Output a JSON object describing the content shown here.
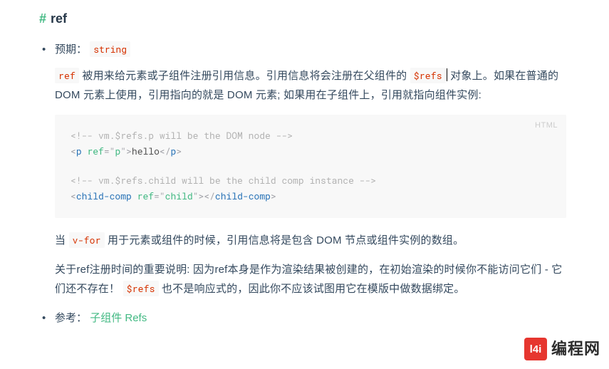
{
  "heading": {
    "hash": "#",
    "title": "ref"
  },
  "items": {
    "expected": {
      "label": "预期：",
      "code": "string"
    },
    "desc1": {
      "pre1": "",
      "code_ref": "ref",
      "text1": " 被用来给元素或子组件注册引用信息。引用信息将会注册在父组件的 ",
      "code_refs": "$refs",
      "text2": " 对象上。如果在普通的 DOM 元素上使用，引用指向的就是 DOM 元素; 如果用在子组件上，引用就指向组件实例:"
    },
    "codeblock": {
      "lang": "HTML",
      "lines": {
        "l1_comment": "<!-- vm.$refs.p will be the DOM node -->",
        "l2": {
          "open_lt": "<",
          "tag_p": "p",
          "sp": " ",
          "attr_ref": "ref",
          "eq": "=",
          "q1": "\"",
          "val_p": "p",
          "q2": "\"",
          "gt": ">",
          "text": "hello",
          "close_lt": "</",
          "close_tag": "p",
          "close_gt": ">"
        },
        "l4_comment": "<!-- vm.$refs.child will be the child comp instance -->",
        "l5": {
          "open_lt": "<",
          "tag": "child-comp",
          "sp": " ",
          "attr_ref": "ref",
          "eq": "=",
          "q1": "\"",
          "val": "child",
          "q2": "\"",
          "gt": ">",
          "close_lt": "</",
          "close_tag": "child-comp",
          "close_gt": ">"
        }
      }
    },
    "desc2": {
      "pre": "当 ",
      "code_vfor": "v-for",
      "text": " 用于元素或组件的时候，引用信息将是包含 DOM 节点或组件实例的数组。"
    },
    "desc3": {
      "text1": "关于ref注册时间的重要说明: 因为ref本身是作为渲染结果被创建的，在初始渲染的时候你不能访问它们 - 它们还不存在！ ",
      "code_refs": "$refs",
      "text2": " 也不是响应式的，因此你不应该试图用它在模版中做数据绑定。"
    },
    "reference": {
      "label": "参考：",
      "link": "子组件 Refs"
    }
  },
  "watermark": {
    "badge": "l4i",
    "text": "编程网"
  }
}
